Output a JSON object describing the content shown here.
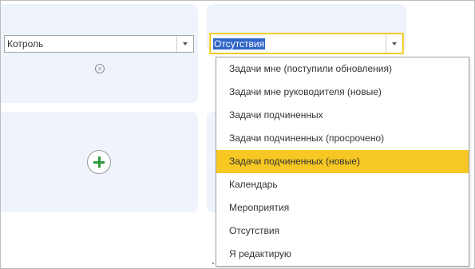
{
  "left_combo": {
    "value": "Котроль"
  },
  "right_combo": {
    "value": "Отсутствия"
  },
  "dropdown": {
    "items": [
      "Задачи мне (поступили обновления)",
      "Задачи мне руководителя (новые)",
      "Задачи подчиненных",
      "Задачи подчиненных (просрочено)",
      "Задачи подчиненных (новые)",
      "Календарь",
      "Мероприятия",
      "Отсутствия",
      "Я редактирую"
    ],
    "highlighted_index": 4
  },
  "colors": {
    "panel": "#eef3fc",
    "highlight": "#f7c823",
    "add_icon": "#2e9b3b",
    "selection": "#2f66c7"
  }
}
